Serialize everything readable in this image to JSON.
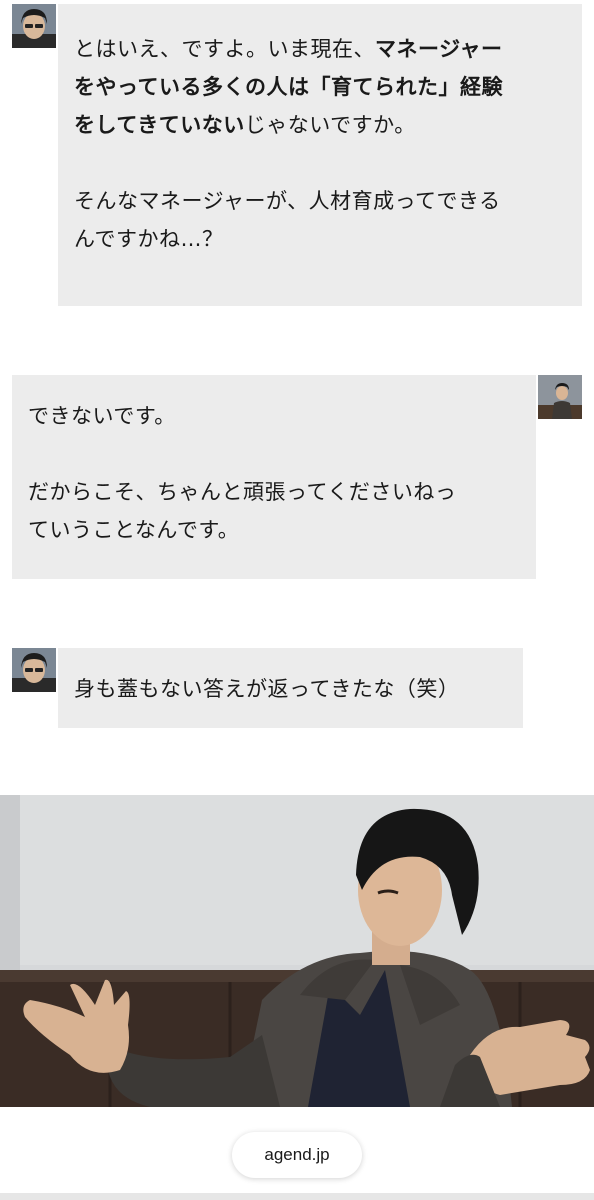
{
  "messages": [
    {
      "speaker": "interviewer",
      "paragraphs": [
        [
          {
            "text": "とはいえ、ですよ。いま現在、"
          },
          {
            "text": "マネージャー",
            "bold": true
          },
          {
            "text": "\n"
          },
          {
            "text": "をやっている多くの人は「育てられた」経験",
            "bold": true
          },
          {
            "text": "\n"
          },
          {
            "text": "をしてきていない",
            "bold": true
          },
          {
            "text": "じゃないですか。"
          }
        ],
        [
          {
            "text": "そんなマネージャーが、人材育成ってできる\nんですかね…？"
          }
        ]
      ]
    },
    {
      "speaker": "interviewee",
      "paragraphs": [
        [
          {
            "text": "できないです。"
          }
        ],
        [
          {
            "text": "だからこそ、ちゃんと頑張ってくださいねっ\nていうことなんです。"
          }
        ]
      ]
    },
    {
      "speaker": "interviewer",
      "paragraphs": [
        [
          {
            "text": "身も蓋もない答えが返ってきたな（笑）"
          }
        ]
      ]
    }
  ],
  "source": {
    "label": "agend.jp"
  },
  "icons": {
    "interviewer_avatar": "avatar-interviewer-icon",
    "interviewee_avatar": "avatar-interviewee-icon"
  },
  "colors": {
    "bubble": "#ececec",
    "text": "#1a1a1a",
    "background": "#ffffff"
  }
}
